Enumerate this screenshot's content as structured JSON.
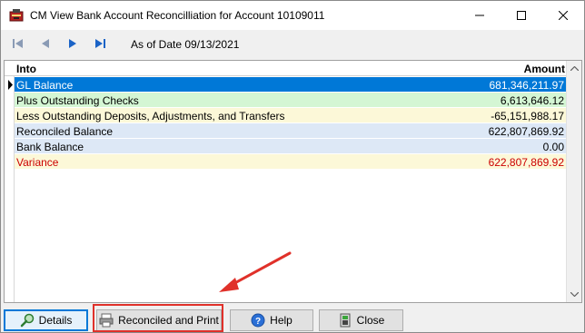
{
  "window": {
    "title": "CM View Bank Account Reconcilliation for Account 10109011"
  },
  "nav": {
    "as_of": "As of Date 09/13/2021"
  },
  "grid": {
    "columns": {
      "into": "Into",
      "amount": "Amount"
    },
    "rows": [
      {
        "label": "GL Balance",
        "amount": "681,346,211.97",
        "bg": "#0078d7",
        "fg": "#ffffff"
      },
      {
        "label": "Plus Outstanding Checks",
        "amount": "6,613,646.12",
        "bg": "#d4f6d4",
        "fg": "#000000"
      },
      {
        "label": "Less Outstanding Deposits, Adjustments, and Transfers",
        "amount": "-65,151,988.17",
        "bg": "#fcf8d8",
        "fg": "#000000"
      },
      {
        "label": "Reconciled Balance",
        "amount": "622,807,869.92",
        "bg": "#dde8f6",
        "fg": "#000000"
      },
      {
        "label": "Bank Balance",
        "amount": "0.00",
        "bg": "#dde8f6",
        "fg": "#000000"
      },
      {
        "label": "Variance",
        "amount": "622,807,869.92",
        "bg": "#fcf8d8",
        "fg": "#cc0000"
      }
    ]
  },
  "buttons": {
    "details": "Details",
    "reconciled_print": "Reconciled and Print",
    "help": "Help",
    "close": "Close"
  },
  "colors": {
    "selection": "#0078d7",
    "annotation": "#e0312a"
  }
}
